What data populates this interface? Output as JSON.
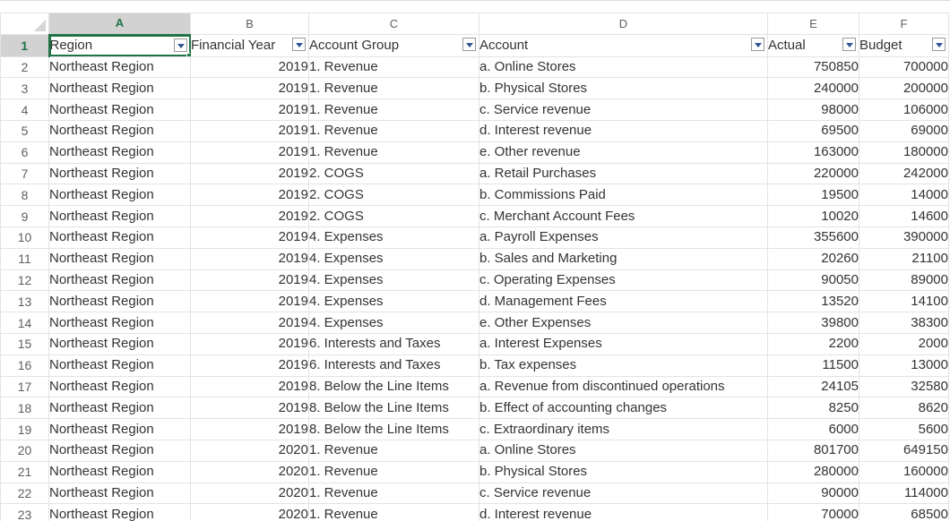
{
  "columns": [
    "A",
    "B",
    "C",
    "D",
    "E",
    "F"
  ],
  "header_row_number": "1",
  "headers": [
    "Region",
    "Financial Year",
    "Account Group",
    "Account",
    "Actual",
    "Budget"
  ],
  "rows": [
    {
      "n": "2",
      "region": "Northeast Region",
      "year": "2019",
      "group": "1. Revenue",
      "account": "a. Online Stores",
      "actual": "750850",
      "budget": "700000"
    },
    {
      "n": "3",
      "region": "Northeast Region",
      "year": "2019",
      "group": "1. Revenue",
      "account": "b. Physical Stores",
      "actual": "240000",
      "budget": "200000"
    },
    {
      "n": "4",
      "region": "Northeast Region",
      "year": "2019",
      "group": "1. Revenue",
      "account": "c. Service revenue",
      "actual": "98000",
      "budget": "106000"
    },
    {
      "n": "5",
      "region": "Northeast Region",
      "year": "2019",
      "group": "1. Revenue",
      "account": "d. Interest revenue",
      "actual": "69500",
      "budget": "69000"
    },
    {
      "n": "6",
      "region": "Northeast Region",
      "year": "2019",
      "group": "1. Revenue",
      "account": "e. Other revenue",
      "actual": "163000",
      "budget": "180000"
    },
    {
      "n": "7",
      "region": "Northeast Region",
      "year": "2019",
      "group": "2. COGS",
      "account": "a. Retail Purchases",
      "actual": "220000",
      "budget": "242000"
    },
    {
      "n": "8",
      "region": "Northeast Region",
      "year": "2019",
      "group": "2. COGS",
      "account": "b. Commissions Paid",
      "actual": "19500",
      "budget": "14000"
    },
    {
      "n": "9",
      "region": "Northeast Region",
      "year": "2019",
      "group": "2. COGS",
      "account": "c. Merchant Account Fees",
      "actual": "10020",
      "budget": "14600"
    },
    {
      "n": "10",
      "region": "Northeast Region",
      "year": "2019",
      "group": "4. Expenses",
      "account": "a. Payroll Expenses",
      "actual": "355600",
      "budget": "390000"
    },
    {
      "n": "11",
      "region": "Northeast Region",
      "year": "2019",
      "group": "4. Expenses",
      "account": "b. Sales and Marketing",
      "actual": "20260",
      "budget": "21100"
    },
    {
      "n": "12",
      "region": "Northeast Region",
      "year": "2019",
      "group": "4. Expenses",
      "account": "c. Operating Expenses",
      "actual": "90050",
      "budget": "89000"
    },
    {
      "n": "13",
      "region": "Northeast Region",
      "year": "2019",
      "group": "4. Expenses",
      "account": "d. Management Fees",
      "actual": "13520",
      "budget": "14100"
    },
    {
      "n": "14",
      "region": "Northeast Region",
      "year": "2019",
      "group": "4. Expenses",
      "account": "e. Other Expenses",
      "actual": "39800",
      "budget": "38300"
    },
    {
      "n": "15",
      "region": "Northeast Region",
      "year": "2019",
      "group": "6. Interests and Taxes",
      "account": "a. Interest Expenses",
      "actual": "2200",
      "budget": "2000"
    },
    {
      "n": "16",
      "region": "Northeast Region",
      "year": "2019",
      "group": "6. Interests and Taxes",
      "account": "b. Tax expenses",
      "actual": "11500",
      "budget": "13000"
    },
    {
      "n": "17",
      "region": "Northeast Region",
      "year": "2019",
      "group": "8. Below the Line Items",
      "account": "a. Revenue from discontinued operations",
      "actual": "24105",
      "budget": "32580"
    },
    {
      "n": "18",
      "region": "Northeast Region",
      "year": "2019",
      "group": "8. Below the Line Items",
      "account": "b. Effect of accounting changes",
      "actual": "8250",
      "budget": "8620"
    },
    {
      "n": "19",
      "region": "Northeast Region",
      "year": "2019",
      "group": "8. Below the Line Items",
      "account": "c. Extraordinary items",
      "actual": "6000",
      "budget": "5600"
    },
    {
      "n": "20",
      "region": "Northeast Region",
      "year": "2020",
      "group": "1. Revenue",
      "account": "a. Online Stores",
      "actual": "801700",
      "budget": "649150"
    },
    {
      "n": "21",
      "region": "Northeast Region",
      "year": "2020",
      "group": "1. Revenue",
      "account": "b. Physical Stores",
      "actual": "280000",
      "budget": "160000"
    },
    {
      "n": "22",
      "region": "Northeast Region",
      "year": "2020",
      "group": "1. Revenue",
      "account": "c. Service revenue",
      "actual": "90000",
      "budget": "114000"
    },
    {
      "n": "23",
      "region": "Northeast Region",
      "year": "2020",
      "group": "1. Revenue",
      "account": "d. Interest revenue",
      "actual": "70000",
      "budget": "68500"
    }
  ],
  "active_cell": "A1",
  "icons": {
    "filter": "filter-dropdown-icon",
    "corner": "select-all-corner-icon"
  },
  "colors": {
    "accent": "#217346",
    "filter_arrow": "#2f5597",
    "grid": "#e3e3e3"
  }
}
